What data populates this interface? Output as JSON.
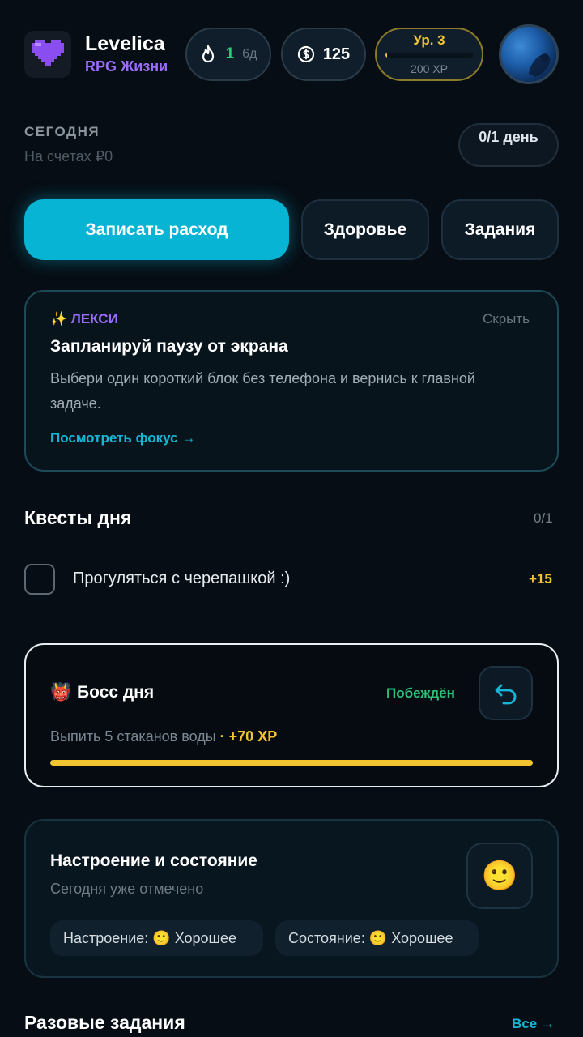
{
  "header": {
    "app_name": "Levelica",
    "app_subtitle": "RPG Жизни",
    "streak": {
      "value": "1",
      "unit": "6д"
    },
    "coins": "125",
    "level": {
      "label": "Ур. 3",
      "xp": "200 XP",
      "progress": 0.02
    }
  },
  "today": {
    "title": "СЕГОДНЯ",
    "balance": "На счетах ₽0",
    "day_progress": "0/1 день"
  },
  "actions": {
    "expense": "Записать расход",
    "health": "Здоровье",
    "tasks": "Задания"
  },
  "lexi": {
    "tag": "✨ ЛЕКСИ",
    "hide": "Скрыть",
    "title": "Запланируй паузу от экрана",
    "text": "Выбери один короткий блок без телефона и вернись к главной задаче.",
    "link": "Посмотреть фокус →"
  },
  "quests": {
    "title": "Квесты дня",
    "count": "0/1",
    "items": [
      {
        "text": "Прогуляться с черепашкой :)",
        "xp": "+15",
        "done": false
      }
    ]
  },
  "boss": {
    "emoji": "👹",
    "title": "Босс дня",
    "status": "Побеждён",
    "desc": "Выпить 5 стаканов воды",
    "sep": " · ",
    "xp": "+70 XP",
    "progress": 1.0
  },
  "mood": {
    "title": "Настроение и состояние",
    "subtitle": "Сегодня уже отмечено",
    "button_emoji": "🙂",
    "mood_chip": "Настроение: 🙂 Хорошее",
    "state_chip": "Состояние: 🙂 Хорошее"
  },
  "once": {
    "title": "Разовые задания",
    "all": "Все →"
  },
  "colors": {
    "accent": "#08b4d4",
    "purple": "#9b6cff",
    "gold": "#f2c530",
    "green": "#2cc27a",
    "background": "#060d14"
  }
}
